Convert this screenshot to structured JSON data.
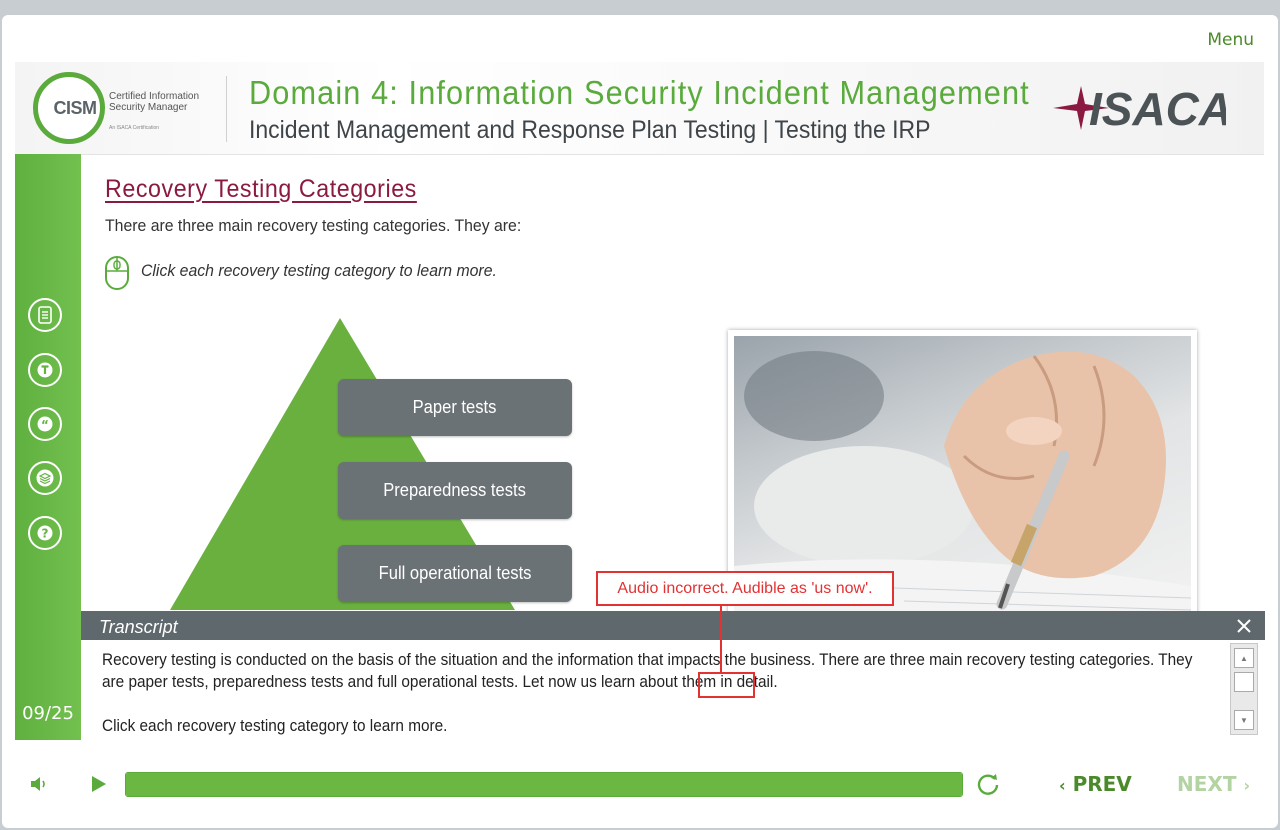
{
  "header": {
    "menu_label": "Menu",
    "logo_text": "CISM",
    "cism_line1": "Certified Information",
    "cism_line2": "Security Manager",
    "cism_line3": "An ISACA Certification",
    "domain_title": "Domain 4: Information Security Incident Management",
    "sub_title": "Incident Management and Response Plan Testing | Testing the IRP",
    "brand": "ISACA"
  },
  "sidebar": {
    "items": [
      {
        "name": "notes-icon"
      },
      {
        "name": "text-icon"
      },
      {
        "name": "quote-icon"
      },
      {
        "name": "layers-icon"
      },
      {
        "name": "help-icon"
      }
    ],
    "slide_number": "09/25"
  },
  "content": {
    "title": "Recovery Testing Categories",
    "intro": "There are three main recovery testing categories. They are:",
    "instruction": "Click each recovery testing category to learn more.",
    "tiers": [
      "Paper tests",
      "Preparedness tests",
      "Full operational tests"
    ]
  },
  "annotation": {
    "note": "Audio incorrect. Audible as 'us now'."
  },
  "transcript": {
    "title": "Transcript",
    "paragraph1": "Recovery testing is conducted on the basis of the situation and the information that impacts the business. There are three main recovery testing categories. They are paper tests, preparedness tests and full operational tests. Let now us learn about them in detail.",
    "paragraph2": "Click each recovery testing category to learn more."
  },
  "controls": {
    "progress": 1.0,
    "prev_label": "PREV",
    "next_label": "NEXT"
  },
  "colors": {
    "accent": "#5aab3c",
    "title_maroon": "#8b1a42",
    "tier_gray": "#6b7275",
    "annotation_red": "#e23232"
  }
}
